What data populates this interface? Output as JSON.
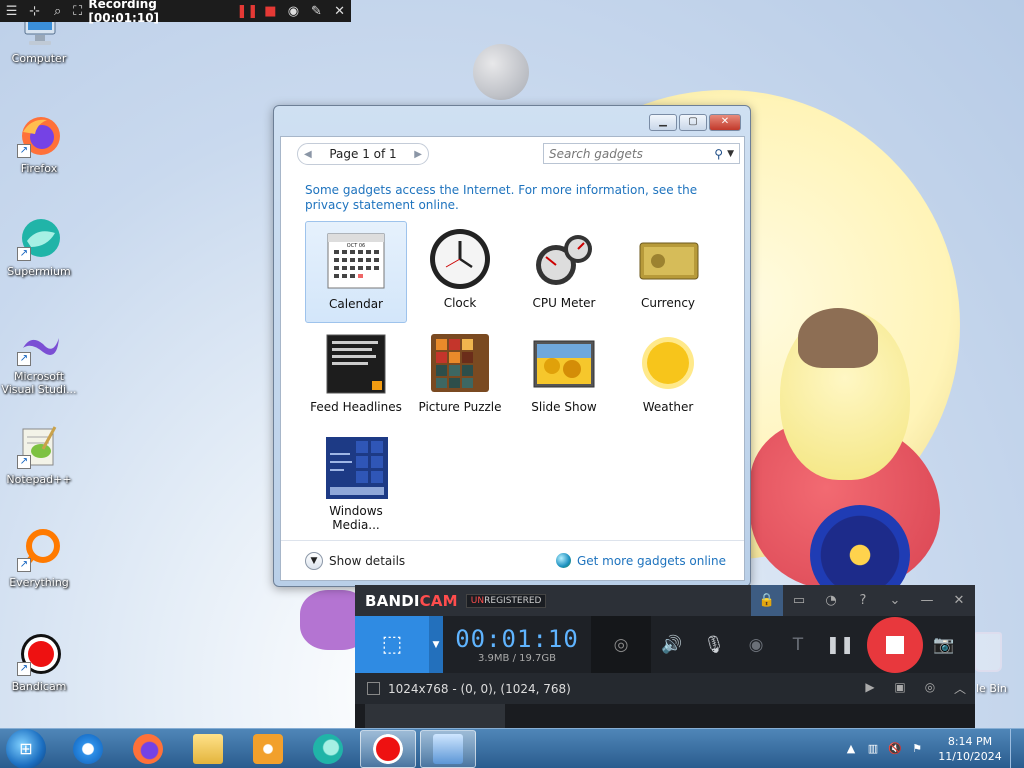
{
  "desktop": {
    "icons": [
      {
        "label": "Computer"
      },
      {
        "label": "Firefox"
      },
      {
        "label": "Supermium"
      },
      {
        "label": "Microsoft Visual Studi..."
      },
      {
        "label": "Notepad++"
      },
      {
        "label": "Everything"
      },
      {
        "label": "Bandicam"
      }
    ],
    "recycle_bin_label": "le Bin"
  },
  "recording_bar": {
    "status": "Recording [00:01:10]",
    "icons": [
      "menu-icon",
      "resize-icon",
      "region-icon",
      "region-select-icon",
      "pause-icon",
      "stop-icon",
      "camera-icon",
      "pencil-icon",
      "close-icon"
    ]
  },
  "gadget_window": {
    "pager": "Page 1 of 1",
    "search_placeholder": "Search gadgets",
    "notice": "Some gadgets access the Internet.  For more information, see the privacy statement online.",
    "gadgets": [
      {
        "label": "Calendar",
        "selected": true
      },
      {
        "label": "Clock"
      },
      {
        "label": "CPU Meter"
      },
      {
        "label": "Currency"
      },
      {
        "label": "Feed Headlines"
      },
      {
        "label": "Picture Puzzle"
      },
      {
        "label": "Slide Show"
      },
      {
        "label": "Weather"
      },
      {
        "label": "Windows Media..."
      }
    ],
    "calendar_month": "OCT 06",
    "show_details": "Show details",
    "get_more": "Get more gadgets online"
  },
  "bandicam": {
    "brand_a": "BANDI",
    "brand_b": "CAM",
    "unreg_a": "UN",
    "unreg_b": "REGISTERED",
    "timer": "00:01:10",
    "size": "3.9MB / 19.7GB",
    "region": "1024x768 - (0, 0), (1024, 768)",
    "colors": {
      "mode_active": "#2f8be3",
      "stop": "#e8383d",
      "timer": "#5fb4ff"
    }
  },
  "taskbar": {
    "apps": [
      "ie-icon",
      "firefox-icon",
      "explorer-icon",
      "media-player-icon",
      "supermium-icon",
      "bandicam-icon",
      "gadgets-icon"
    ],
    "time": "8:14 PM",
    "date": "11/10/2024"
  }
}
